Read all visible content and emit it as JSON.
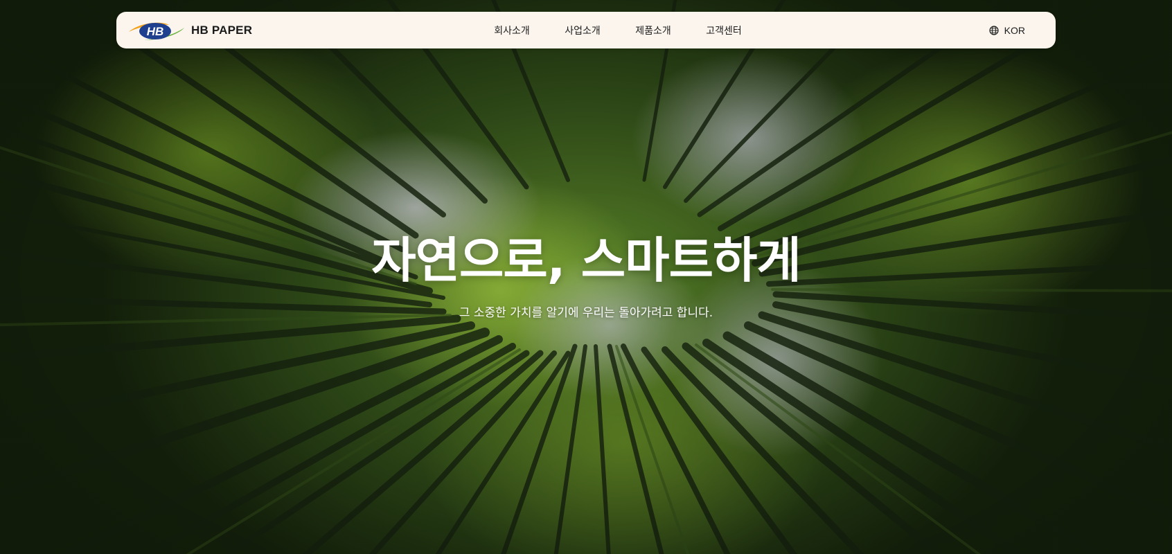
{
  "nav": {
    "logo_mark": "HB",
    "brand": "HB PAPER",
    "menu": [
      {
        "label": "회사소개"
      },
      {
        "label": "사업소개"
      },
      {
        "label": "제품소개"
      },
      {
        "label": "고객센터"
      }
    ],
    "language": "KOR",
    "language_icon": "globe-icon"
  },
  "hero": {
    "headline": "자연으로, 스마트하게",
    "subline": "그 소중한 가치를 알기에 우리는 돌아가려고 합니다.",
    "background": "bamboo-forest-looking-up"
  },
  "colors": {
    "nav_background": "#fbf5ee",
    "logo_blue": "#1f3f8f",
    "logo_orange": "#f2a21a",
    "logo_green": "#6cb33f",
    "text_dark": "#1c1c1c",
    "hero_text": "#ffffff"
  }
}
